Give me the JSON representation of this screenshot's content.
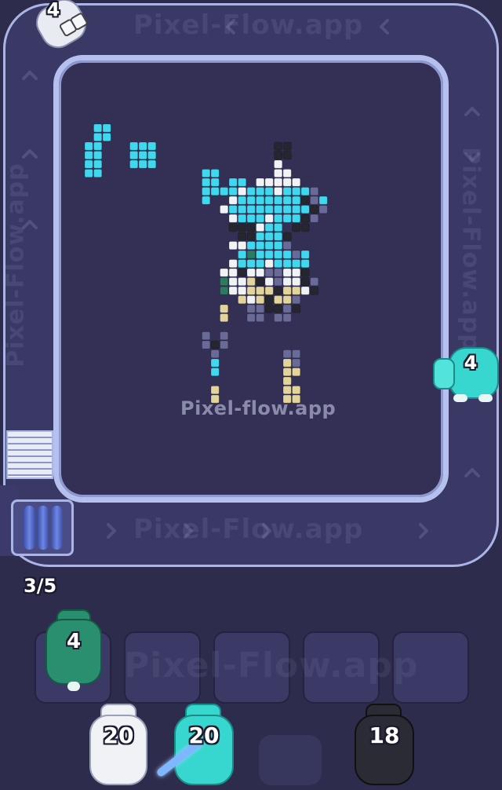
{
  "watermark": "Pixel-flow.app",
  "watermark_track": "Pixel-Flow.app",
  "track_shooters": [
    {
      "count": "4",
      "color": "#e8ecf2",
      "position": "top-left corner"
    },
    {
      "count": "4",
      "color": "#37d6cf",
      "position": "right side"
    }
  ],
  "capacity": "3/5",
  "waiting_slots": [
    {
      "count": "4",
      "color": "#2a8f6f",
      "occupied": true
    },
    {
      "occupied": false
    },
    {
      "occupied": false
    },
    {
      "occupied": false
    },
    {
      "occupied": false
    }
  ],
  "queue": [
    {
      "count": "20",
      "color": "#f0f2f6"
    },
    {
      "count": "20",
      "color": "#37d6cf"
    },
    {
      "count": "18",
      "color": "#2b2b35"
    }
  ],
  "palette": {
    "background": "#2e2c4d",
    "board": "#332f55",
    "track": "#3a3864",
    "rail": "#aab5e6",
    "cyan": "#3fd8ee",
    "white": "#f0f2f6",
    "black": "#262630",
    "slate": "#6a6a98",
    "green": "#2c7a60",
    "sand": "#e2d49a"
  }
}
